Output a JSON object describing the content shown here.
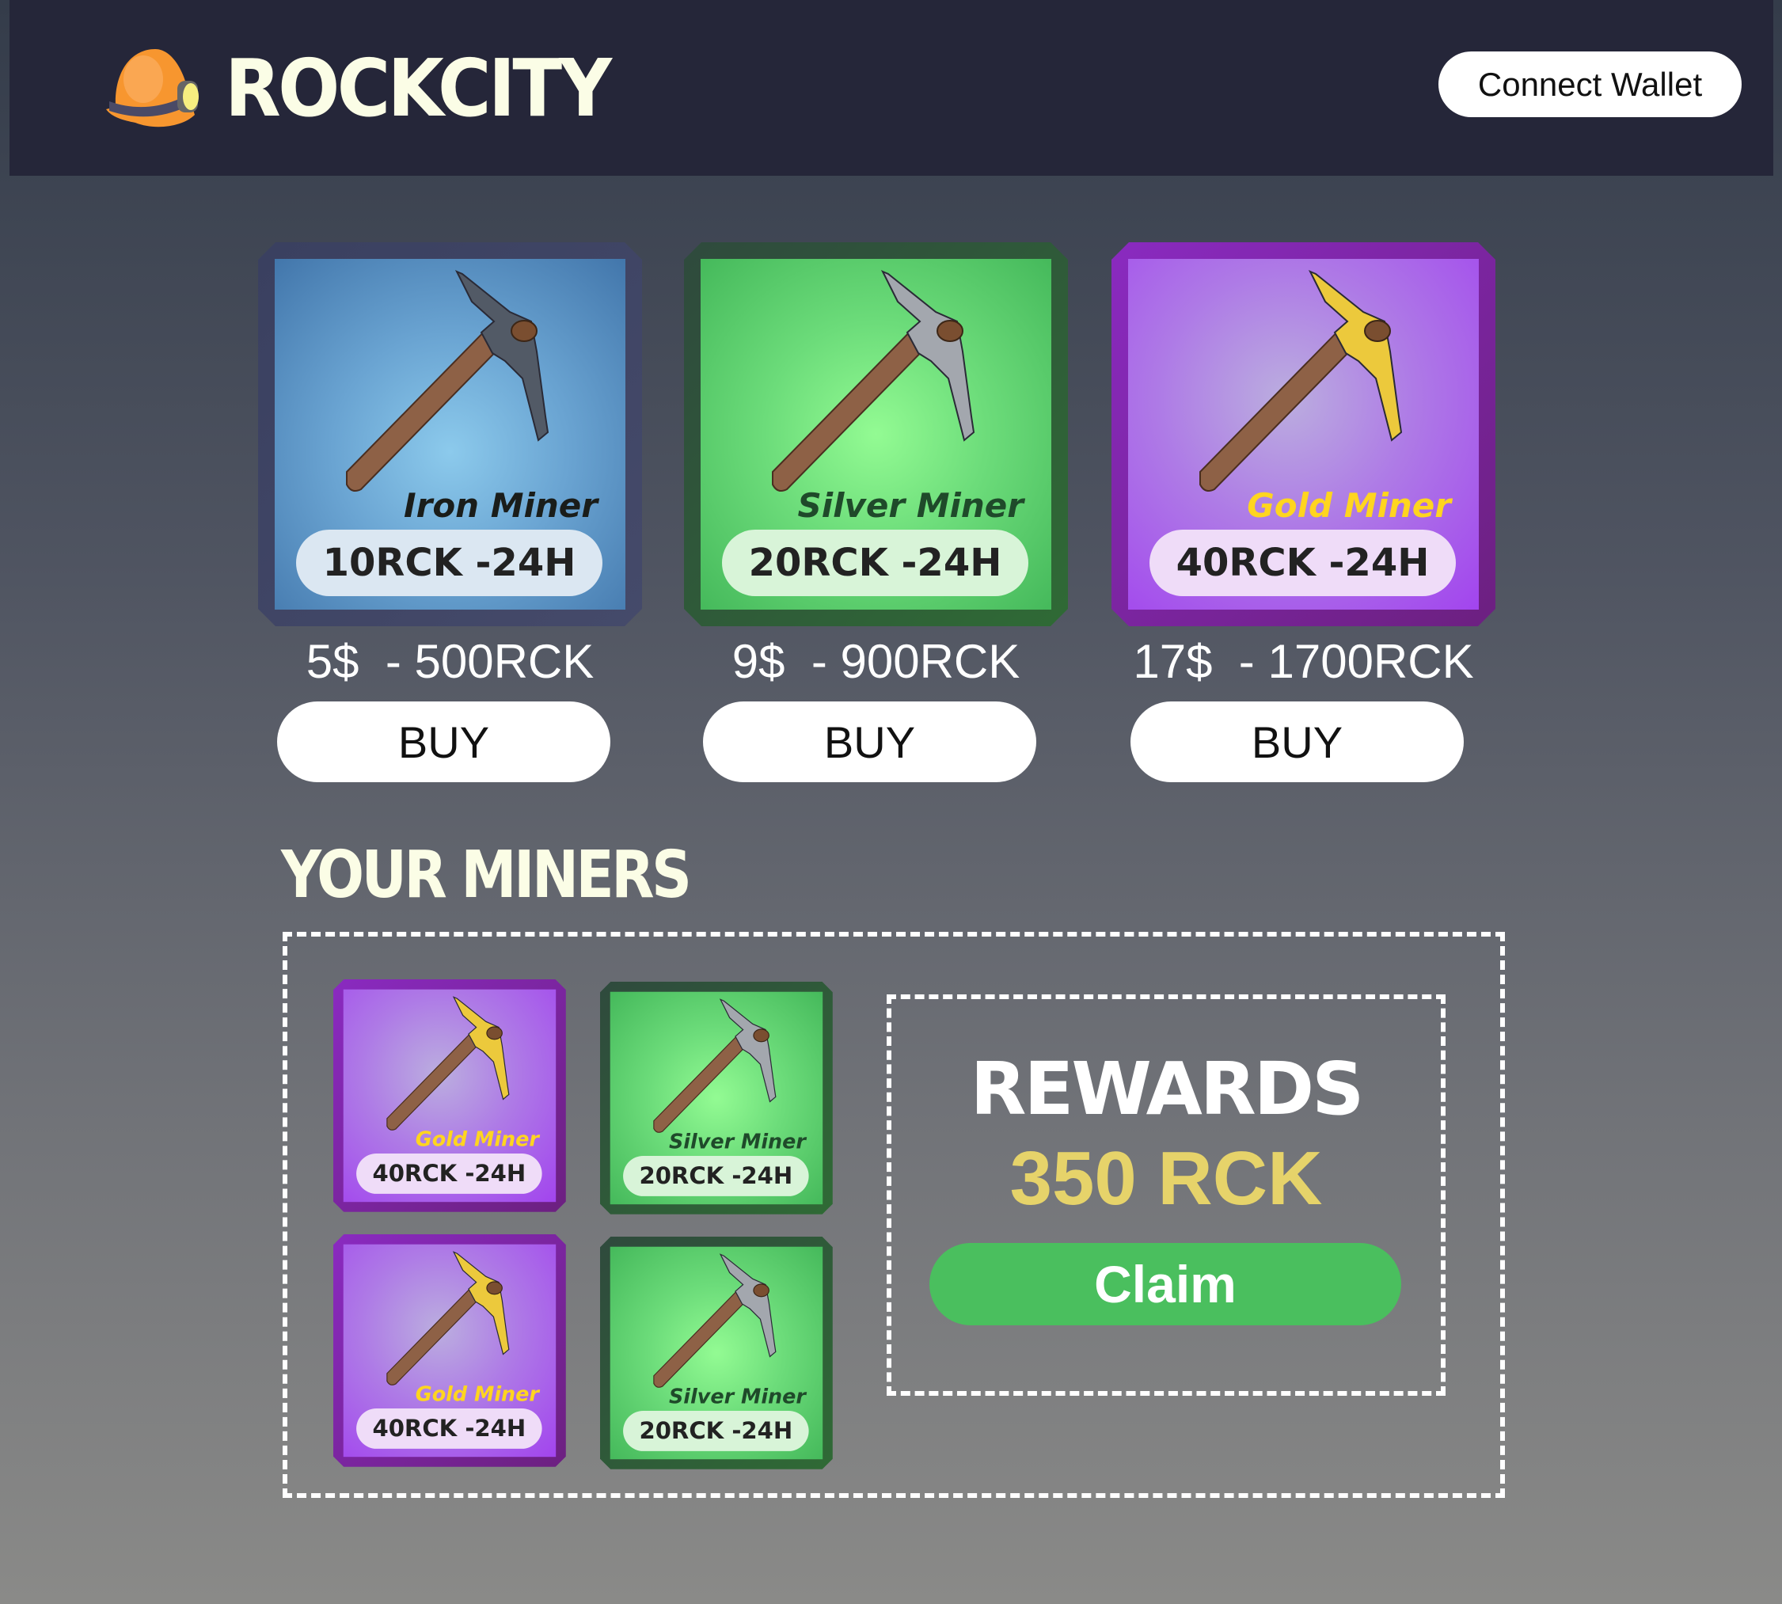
{
  "header": {
    "brand": "ROCKCITY",
    "connect_wallet": "Connect Wallet"
  },
  "shop": [
    {
      "tier": "iron",
      "name": "Iron Miner",
      "rate": "10RCK -24H",
      "price": "5$  - 500RCK",
      "buy": "BUY"
    },
    {
      "tier": "silver",
      "name": "Silver Miner",
      "rate": "20RCK -24H",
      "price": "9$  - 900RCK",
      "buy": "BUY"
    },
    {
      "tier": "gold",
      "name": "Gold Miner",
      "rate": "40RCK -24H",
      "price": "17$  - 1700RCK",
      "buy": "BUY"
    }
  ],
  "your_miners": {
    "title": "YOUR MINERS",
    "items": [
      {
        "tier": "gold",
        "name": "Gold Miner",
        "rate": "40RCK -24H"
      },
      {
        "tier": "silver",
        "name": "Silver Miner",
        "rate": "20RCK -24H"
      },
      {
        "tier": "gold",
        "name": "Gold Miner",
        "rate": "40RCK -24H"
      },
      {
        "tier": "silver",
        "name": "Silver Miner",
        "rate": "20RCK -24H"
      }
    ]
  },
  "rewards": {
    "title": "REWARDS",
    "amount": "350 RCK",
    "claim": "Claim"
  },
  "colors": {
    "header": "#252639",
    "claim": "#4abf5e",
    "amount": "#e6d36a",
    "gold_name": "#ffd51f"
  }
}
